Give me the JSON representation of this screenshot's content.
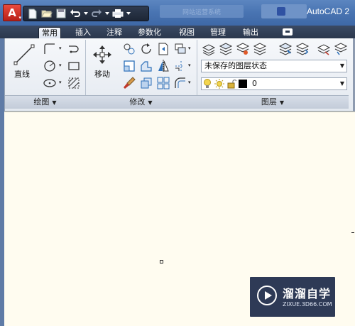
{
  "titlebar": {
    "app_logo": "A",
    "blurred_text_1": "网站运营系统",
    "blurred_text_2": "",
    "app_title": "AutoCAD 2"
  },
  "tabs": [
    {
      "label": "常用",
      "active": true
    },
    {
      "label": "插入",
      "active": false
    },
    {
      "label": "注释",
      "active": false
    },
    {
      "label": "参数化",
      "active": false
    },
    {
      "label": "视图",
      "active": false
    },
    {
      "label": "管理",
      "active": false
    },
    {
      "label": "输出",
      "active": false
    }
  ],
  "ribbon": {
    "draw": {
      "line_label": "直线",
      "footer": "绘图"
    },
    "modify": {
      "move_label": "移动",
      "footer": "修改"
    },
    "layers": {
      "layer_state": "未保存的图层状态",
      "current_layer": "0",
      "footer": "图层"
    }
  },
  "watermark": {
    "title": "溜溜自学",
    "url": "ZIXUE.3D66.COM"
  },
  "colors": {
    "canvas": "#fffcf0",
    "titlebar": "#4a75b3",
    "ribbon": "#eef1f6",
    "brand_red": "#d0271d"
  }
}
